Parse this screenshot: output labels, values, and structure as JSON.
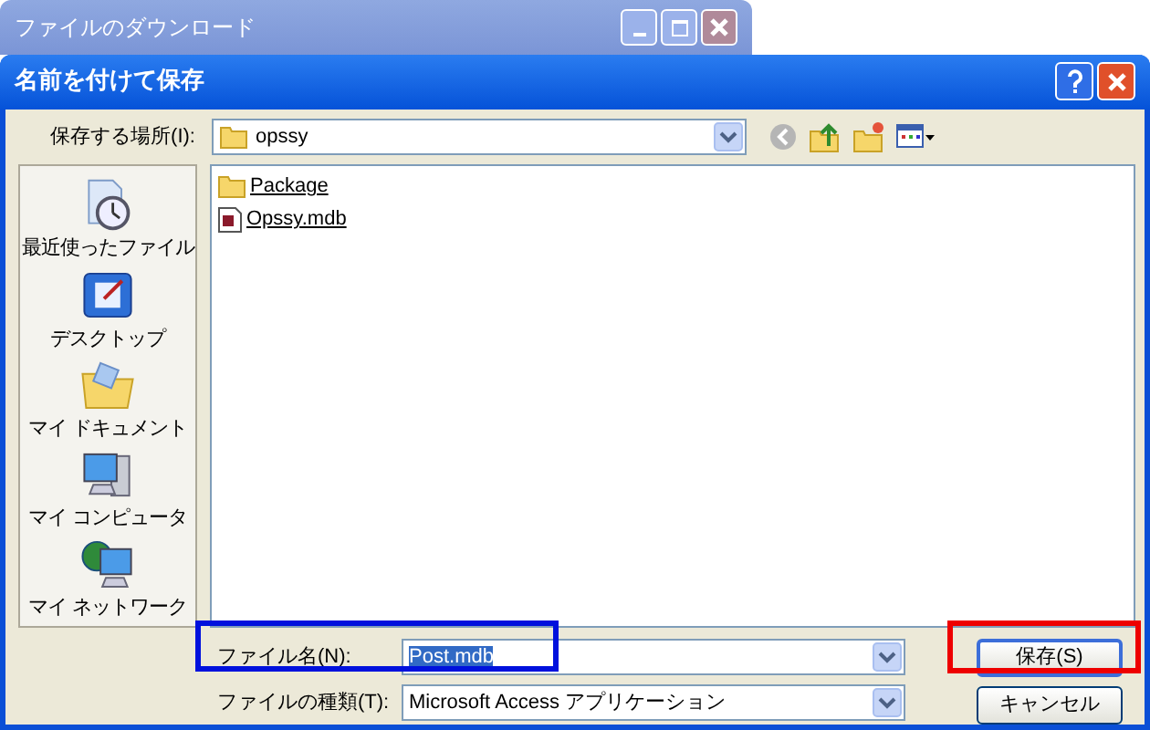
{
  "background_window": {
    "title": "ファイルのダウンロード"
  },
  "dialog": {
    "title": "名前を付けて保存"
  },
  "save_in": {
    "label": "保存する場所(I):",
    "value": "opssy"
  },
  "places": [
    {
      "label": "最近使ったファイル",
      "kind": "recent"
    },
    {
      "label": "デスクトップ",
      "kind": "desktop"
    },
    {
      "label": "マイ ドキュメント",
      "kind": "documents"
    },
    {
      "label": "マイ コンピュータ",
      "kind": "computer"
    },
    {
      "label": "マイ ネットワーク",
      "kind": "network"
    }
  ],
  "files": [
    {
      "name": "Package",
      "kind": "folder"
    },
    {
      "name": "Opssy.mdb",
      "kind": "database"
    }
  ],
  "file_name": {
    "label": "ファイル名(N):",
    "value": "Post.mdb",
    "selected": true
  },
  "file_type": {
    "label": "ファイルの種類(T):",
    "value": "Microsoft Access アプリケーション"
  },
  "buttons": [
    {
      "label": "保存(S)",
      "kind": "primary"
    },
    {
      "label": "キャンセル",
      "kind": "cancel"
    }
  ]
}
